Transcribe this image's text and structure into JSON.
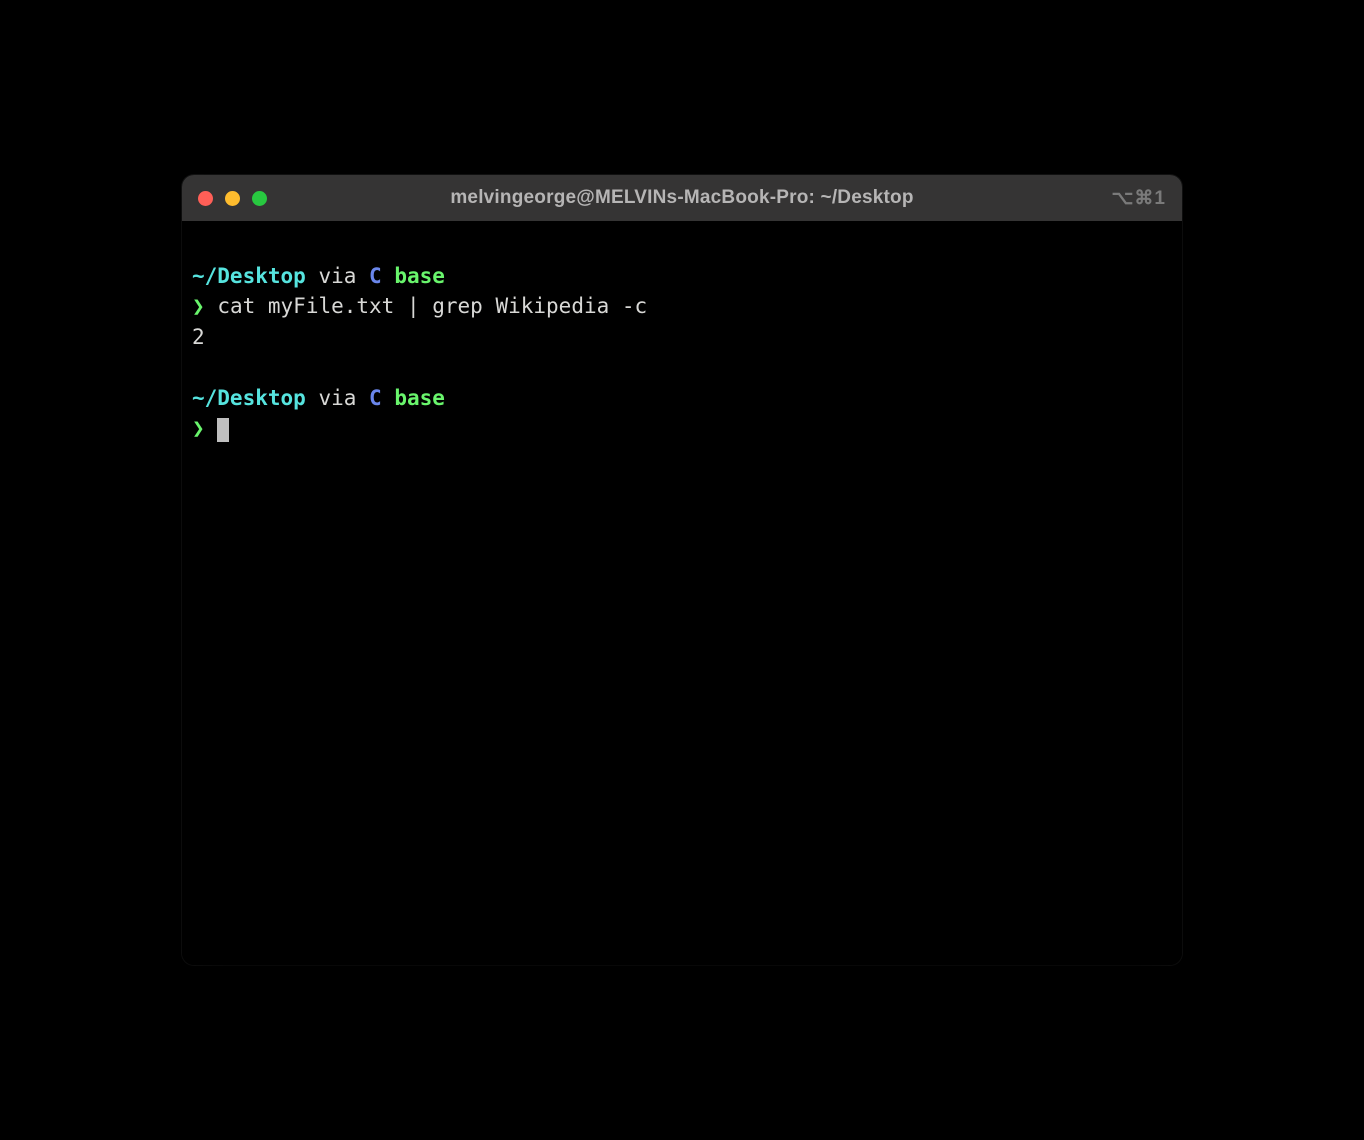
{
  "window": {
    "title": "melvingeorge@MELVINs-MacBook-Pro: ~/Desktop",
    "shortcut_hint": "⌥⌘1"
  },
  "session": {
    "prompt1": {
      "path": "~/Desktop",
      "via": "via",
      "lang": "C",
      "env": "base",
      "arrow": "❯",
      "command": "cat myFile.txt | grep Wikipedia -c"
    },
    "output1": "2",
    "prompt2": {
      "path": "~/Desktop",
      "via": "via",
      "lang": "C",
      "env": "base",
      "arrow": "❯"
    }
  }
}
